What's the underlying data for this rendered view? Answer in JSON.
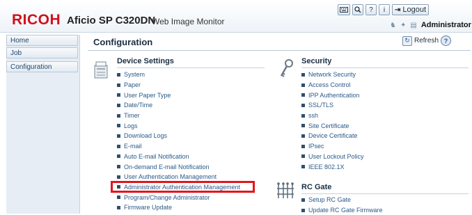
{
  "header": {
    "logo_text": "RICOH",
    "model": "Aficio SP C320DN",
    "app_name": "Web Image Monitor",
    "toolbar": {
      "icon_keyboard": "keyboard-icon",
      "icon_search": "search-icon",
      "icon_help": "?",
      "icon_info": "i",
      "logout_label": "Logout"
    },
    "user_label": "Administrator"
  },
  "sidebar": {
    "items": [
      {
        "label": "Home"
      },
      {
        "label": "Job"
      },
      {
        "label": "Configuration"
      }
    ]
  },
  "main": {
    "title": "Configuration",
    "refresh_label": "Refresh",
    "device_settings": {
      "heading": "Device Settings",
      "items": [
        "System",
        "Paper",
        "User Paper Type",
        "Date/Time",
        "Timer",
        "Logs",
        "Download Logs",
        "E-mail",
        "Auto E-mail Notification",
        "On-demand E-mail Notification",
        "User Authentication Management",
        "Administrator Authentication Management",
        "Program/Change Administrator",
        "Firmware Update"
      ]
    },
    "security": {
      "heading": "Security",
      "items": [
        "Network Security",
        "Access Control",
        "IPP Authentication",
        "SSL/TLS",
        "ssh",
        "Site Certificate",
        "Device Certificate",
        "IPsec",
        "User Lockout Policy",
        "IEEE 802.1X"
      ]
    },
    "rc_gate": {
      "heading": "RC Gate",
      "items": [
        "Setup RC Gate",
        "Update RC Gate Firmware"
      ]
    }
  },
  "colors": {
    "brand_red": "#d0101b",
    "link_blue": "#2a5a8a",
    "highlight_red": "#e4141c"
  }
}
